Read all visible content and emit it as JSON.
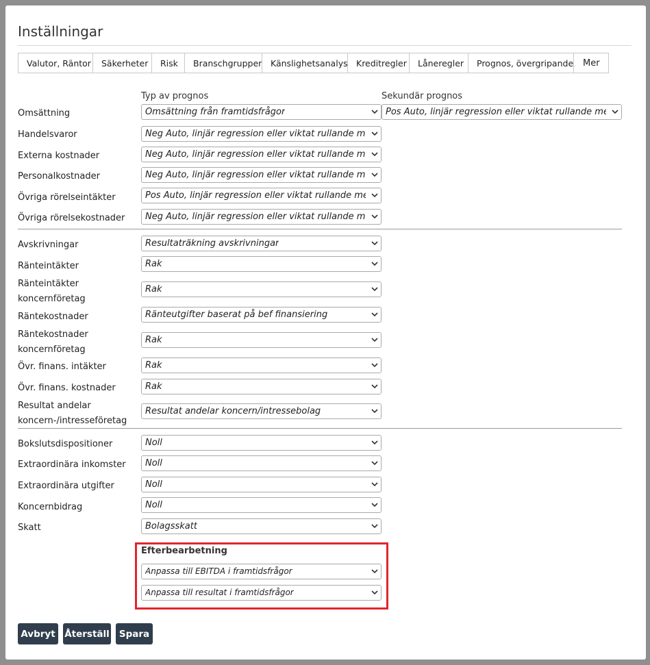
{
  "dialog": {
    "title": "Inställningar"
  },
  "tabs": [
    "Valutor, Räntor",
    "Säkerheter",
    "Risk",
    "Branschgrupper",
    "Känslighetsanalys",
    "Kreditregler",
    "Låneregler",
    "Prognos, övergripande",
    "Mer"
  ],
  "columns": {
    "primary": "Typ av prognos",
    "secondary": "Sekundär prognos"
  },
  "rows": [
    {
      "label": "Omsättning",
      "value": "Omsättning från framtidsfrågor",
      "secondary": "Pos Auto, linjär regression eller viktat rullande medelvärde"
    },
    {
      "label": "Handelsvaror",
      "value": "Neg Auto, linjär regression eller viktat rullande medelvärde"
    },
    {
      "label": "Externa kostnader",
      "value": "Neg Auto, linjär regression eller viktat rullande medelvärde"
    },
    {
      "label": "Personalkostnader",
      "value": "Neg Auto, linjär regression eller viktat rullande medelvärde"
    },
    {
      "label": "Övriga rörelseintäkter",
      "value": "Pos Auto, linjär regression eller viktat rullande medelvärde"
    },
    {
      "label": "Övriga rörelsekostnader",
      "value": "Neg Auto, linjär regression eller viktat rullande medelvärde"
    },
    {
      "label": "Avskrivningar",
      "value": "Resultaträkning avskrivningar"
    },
    {
      "label": "Ränteintäkter",
      "value": "Rak"
    },
    {
      "label": "Ränteintäkter koncernföretag",
      "value": "Rak"
    },
    {
      "label": "Räntekostnader",
      "value": "Ränteutgifter baserat på bef finansiering"
    },
    {
      "label": "Räntekostnader koncernföretag",
      "value": "Rak"
    },
    {
      "label": "Övr. finans. intäkter",
      "value": "Rak"
    },
    {
      "label": "Övr. finans. kostnader",
      "value": "Rak"
    },
    {
      "label": "Resultat andelar koncern-/intresseföretag",
      "value": "Resultat andelar koncern/intressebolag"
    },
    {
      "label": "Bokslutsdispositioner",
      "value": "Noll"
    },
    {
      "label": "Extraordinära inkomster",
      "value": "Noll"
    },
    {
      "label": "Extraordinära utgifter",
      "value": "Noll"
    },
    {
      "label": "Koncernbidrag",
      "value": "Noll"
    },
    {
      "label": "Skatt",
      "value": "Bolagsskatt"
    }
  ],
  "post_processing": {
    "heading": "Efterbearbetning",
    "ebitda": "Anpassa till EBITDA i framtidsfrågor",
    "result": "Anpassa till resultat i framtidsfrågor"
  },
  "buttons": {
    "cancel": "Avbryt",
    "reset": "Återställ",
    "save": "Spara"
  },
  "colors": {
    "button_bg": "#2f3d4c",
    "highlight": "#e0262d"
  }
}
